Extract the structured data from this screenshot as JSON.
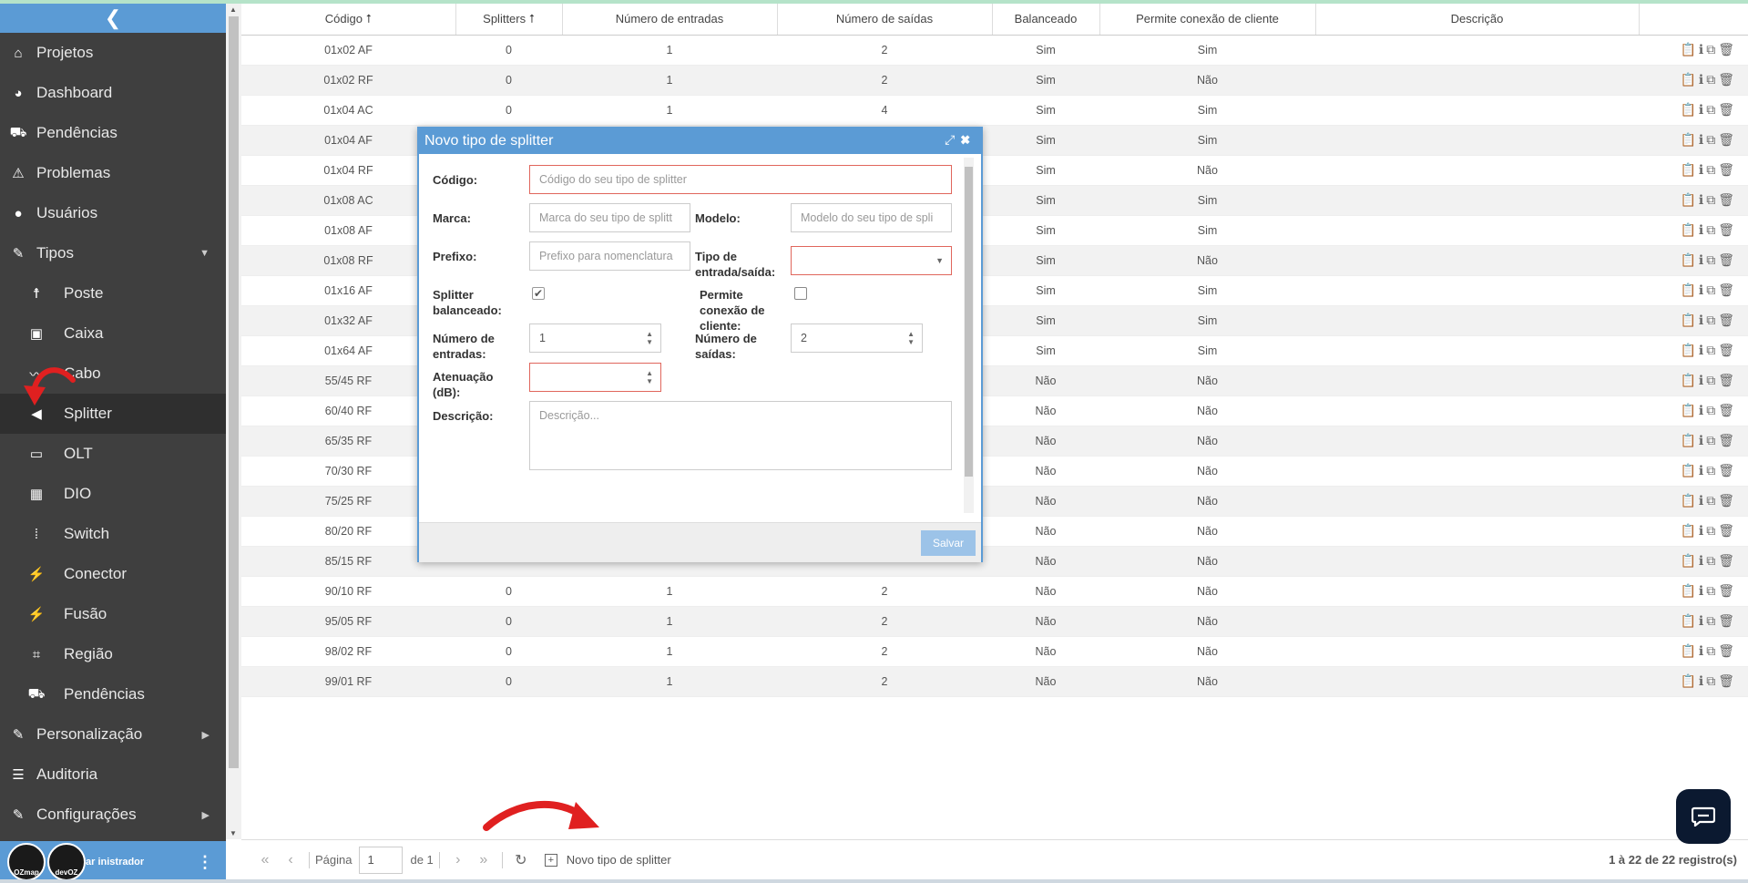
{
  "sidebar": {
    "items": [
      {
        "label": "Projetos",
        "icon": "home-icon",
        "glyph": "⌂"
      },
      {
        "label": "Dashboard",
        "icon": "pie-chart-icon",
        "glyph": "◕"
      },
      {
        "label": "Pendências",
        "icon": "truck-clock-icon",
        "glyph": "⛟"
      },
      {
        "label": "Problemas",
        "icon": "warning-icon",
        "glyph": "⚠"
      },
      {
        "label": "Usuários",
        "icon": "user-icon",
        "glyph": "●"
      },
      {
        "label": "Tipos",
        "icon": "wrench-icon",
        "glyph": "✎"
      },
      {
        "label": "Poste",
        "icon": "pole-icon",
        "glyph": "☨"
      },
      {
        "label": "Caixa",
        "icon": "box-icon",
        "glyph": "▣"
      },
      {
        "label": "Cabo",
        "icon": "cable-icon",
        "glyph": "〰"
      },
      {
        "label": "Splitter",
        "icon": "splitter-icon",
        "glyph": "◀"
      },
      {
        "label": "OLT",
        "icon": "olt-icon",
        "glyph": "▭"
      },
      {
        "label": "DIO",
        "icon": "dio-icon",
        "glyph": "▦"
      },
      {
        "label": "Switch",
        "icon": "switch-icon",
        "glyph": "⁞"
      },
      {
        "label": "Conector",
        "icon": "plug-icon",
        "glyph": "⚡"
      },
      {
        "label": "Fusão",
        "icon": "fusion-icon",
        "glyph": "⚡"
      },
      {
        "label": "Região",
        "icon": "crop-icon",
        "glyph": "⌗"
      },
      {
        "label": "Pendências",
        "icon": "truck-clock-icon",
        "glyph": "⛟"
      },
      {
        "label": "Personalização",
        "icon": "pencil-icon",
        "glyph": "✎"
      },
      {
        "label": "Auditoria",
        "icon": "list-icon",
        "glyph": "☰"
      },
      {
        "label": "Configurações",
        "icon": "wrench-icon",
        "glyph": "✎"
      }
    ],
    "user_label": "ar    inistrador",
    "logo1": "OZmap",
    "logo2": "devOZ"
  },
  "table": {
    "headers": [
      "Código ⭡",
      "Splitters ⭡",
      "Número de entradas",
      "Número de saídas",
      "Balanceado",
      "Permite conexão de cliente",
      "Descrição",
      ""
    ],
    "rows": [
      [
        "01x02 AF",
        "0",
        "1",
        "2",
        "Sim",
        "Sim"
      ],
      [
        "01x02 RF",
        "0",
        "1",
        "2",
        "Sim",
        "Não"
      ],
      [
        "01x04 AC",
        "0",
        "1",
        "4",
        "Sim",
        "Sim"
      ],
      [
        "01x04 AF",
        "",
        "",
        "",
        "Sim",
        "Sim"
      ],
      [
        "01x04 RF",
        "",
        "",
        "",
        "Sim",
        "Não"
      ],
      [
        "01x08 AC",
        "",
        "",
        "",
        "Sim",
        "Sim"
      ],
      [
        "01x08 AF",
        "",
        "",
        "",
        "Sim",
        "Sim"
      ],
      [
        "01x08 RF",
        "",
        "",
        "",
        "Sim",
        "Não"
      ],
      [
        "01x16 AF",
        "",
        "",
        "",
        "Sim",
        "Sim"
      ],
      [
        "01x32 AF",
        "",
        "",
        "",
        "Sim",
        "Sim"
      ],
      [
        "01x64 AF",
        "",
        "",
        "",
        "Sim",
        "Sim"
      ],
      [
        "55/45 RF",
        "",
        "",
        "",
        "Não",
        "Não"
      ],
      [
        "60/40 RF",
        "",
        "",
        "",
        "Não",
        "Não"
      ],
      [
        "65/35 RF",
        "",
        "",
        "",
        "Não",
        "Não"
      ],
      [
        "70/30 RF",
        "",
        "",
        "",
        "Não",
        "Não"
      ],
      [
        "75/25 RF",
        "",
        "",
        "",
        "Não",
        "Não"
      ],
      [
        "80/20 RF",
        "",
        "",
        "",
        "Não",
        "Não"
      ],
      [
        "85/15 RF",
        "",
        "",
        "",
        "Não",
        "Não"
      ],
      [
        "90/10 RF",
        "0",
        "1",
        "2",
        "Não",
        "Não"
      ],
      [
        "95/05 RF",
        "0",
        "1",
        "2",
        "Não",
        "Não"
      ],
      [
        "98/02 RF",
        "0",
        "1",
        "2",
        "Não",
        "Não"
      ],
      [
        "99/01 RF",
        "0",
        "1",
        "2",
        "Não",
        "Não"
      ]
    ],
    "actions_glyphs": "📋ℹ⧉🗑"
  },
  "pager": {
    "page_label": "Página",
    "page_value": "1",
    "of_label": "de 1",
    "new_label": "Novo tipo de splitter",
    "info": "1 à 22 de 22 registro(s)"
  },
  "dialog": {
    "title": "Novo tipo de splitter",
    "codigo_label": "Código:",
    "codigo_placeholder": "Código do seu tipo de splitter",
    "marca_label": "Marca:",
    "marca_placeholder": "Marca do seu tipo de splitt",
    "modelo_label": "Modelo:",
    "modelo_placeholder": "Modelo do seu tipo de spli",
    "prefixo_label": "Prefixo:",
    "prefixo_placeholder": "Prefixo para nomenclatura",
    "tipo_label": "Tipo de entrada/saída:",
    "balanceado_label": "Splitter balanceado:",
    "permite_label": "Permite conexão de cliente:",
    "entradas_label": "Número de entradas:",
    "entradas_value": "1",
    "saidas_label": "Número de saídas:",
    "saidas_value": "2",
    "atenuacao_label": "Atenuação (dB):",
    "descricao_label": "Descrição:",
    "descricao_placeholder": "Descrição...",
    "save_label": "Salvar"
  },
  "colors": {
    "accent": "#5b9bd5",
    "sidebar": "#3f3f3f",
    "error_border": "#e0665c",
    "annotation_arrow": "#e02020"
  }
}
